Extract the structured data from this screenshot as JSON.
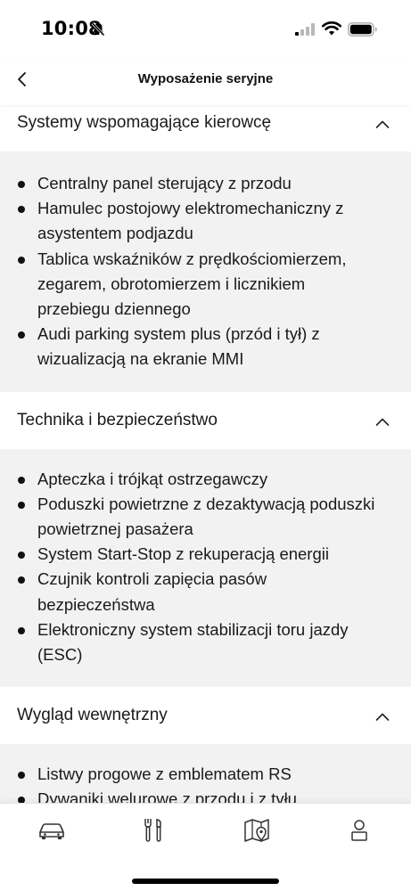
{
  "status_bar": {
    "time": "10:08",
    "icons": [
      "bell-muted-icon",
      "cellular-signal-icon",
      "wifi-icon",
      "battery-icon"
    ]
  },
  "header": {
    "back_icon": "chevron-left-icon",
    "title": "Wyposażenie seryjne"
  },
  "sections": [
    {
      "title": "Systemy wspomagające kierowcę",
      "expanded": true,
      "items_lines": [
        [
          "Centralny panel sterujący z przodu"
        ],
        [
          "Hamulec postojowy elektromechaniczny z",
          "asystentem podjazdu"
        ],
        [
          "Tablica wskaźników z prędkościomierzem,",
          "zegarem, obrotomierzem i licznikiem",
          "przebiegu dziennego"
        ],
        [
          "Audi parking system plus (przód i tył) z",
          "wizualizacją na ekranie MMI"
        ]
      ]
    },
    {
      "title": "Technika i bezpieczeństwo",
      "expanded": true,
      "items_lines": [
        [
          "Apteczka i trójkąt ostrzegawczy"
        ],
        [
          "Poduszki powietrzne z dezaktywacją poduszki",
          "powietrznej pasażera"
        ],
        [
          "System Start-Stop z rekuperacją energii"
        ],
        [
          "Czujnik kontroli zapięcia pasów",
          "bezpieczeństwa"
        ],
        [
          "Elektroniczny system stabilizacji toru jazdy",
          "(ESC)"
        ]
      ]
    },
    {
      "title": "Wygląd wewnętrzny",
      "expanded": true,
      "items_lines": [
        [
          "Listwy progowe z emblematem RS"
        ],
        [
          "Dywaniki welurowe z przodu i z tyłu"
        ]
      ]
    }
  ],
  "bottom_nav": {
    "items": [
      {
        "icon": "car-icon"
      },
      {
        "icon": "service-tools-icon"
      },
      {
        "icon": "map-location-icon"
      },
      {
        "icon": "profile-icon"
      }
    ]
  },
  "colors": {
    "section_background": "#f2f2f2",
    "text": "#1a1a1a",
    "header_background": "#ffffff"
  }
}
